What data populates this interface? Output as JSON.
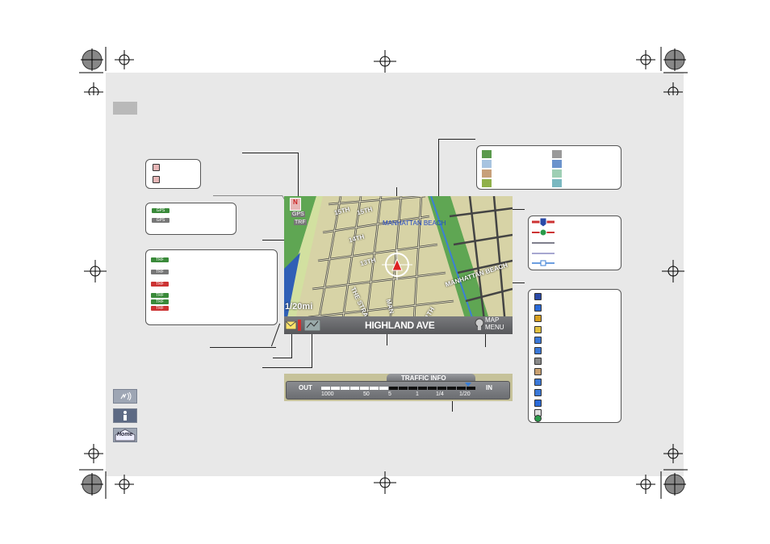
{
  "map": {
    "street_name": "HIGHLAND AVE",
    "scale": "1/20mi",
    "map_menu_line1": "MAP",
    "map_menu_line2": "MENU",
    "city_label_1": "MANHATTAN BEACH",
    "city_label_2": "MANHATTAN BEACH",
    "street_15th": "15TH",
    "street_14th": "14TH",
    "street_13th": "13TH",
    "street_strand": "THE STRAND",
    "street_man": "MAN",
    "street_11th": "11TH",
    "north_badge": "N",
    "gps_badge": "GPS",
    "trf_badge": "TRF"
  },
  "traffic": {
    "title": "TRAFFIC INFO",
    "out": "OUT",
    "in": "IN",
    "ticks": [
      "1000",
      "50",
      "5",
      "1",
      "1/4",
      "1/20"
    ]
  },
  "callouts": {
    "heading_box": [
      "",
      ""
    ],
    "gps_box": [
      "GPS",
      "GPS"
    ],
    "trf_box": [
      "TRF",
      "TRF",
      "TRF",
      "TRF",
      "TRF",
      "TRF"
    ]
  },
  "colors": {
    "page_bg": "#e8e8e8",
    "map_land": "#d7d3a6",
    "ocean": "#2f5fb6",
    "park": "#5fa653",
    "bar": "#686a6e",
    "legend": [
      "#5a9a4c",
      "#a8c4e0",
      "#c7a07a",
      "#8fb04a",
      "#9a9a9a",
      "#6b93cc",
      "#9ecfb4",
      "#7ab8c0"
    ]
  },
  "sidebar": {
    "icons": [
      "voice-icon",
      "info-icon",
      "home-icon"
    ],
    "home_label": "Home"
  }
}
